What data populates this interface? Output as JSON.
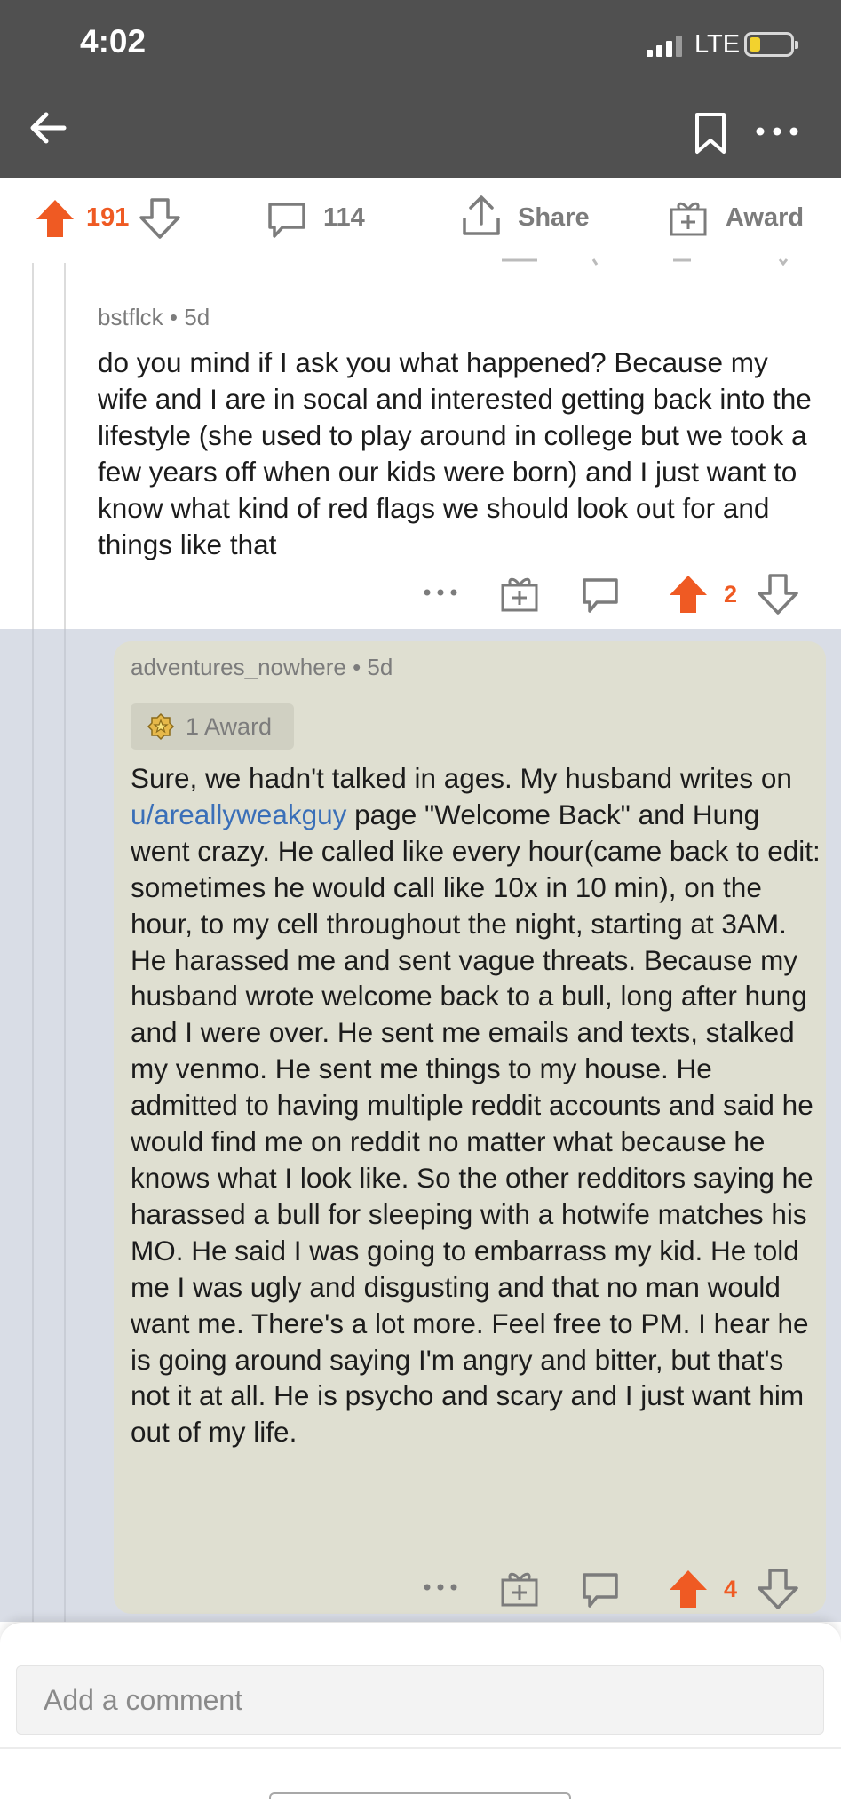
{
  "status_bar": {
    "time": "4:02",
    "network": "LTE"
  },
  "post_actions": {
    "score": "191",
    "comments": "114",
    "share_label": "Share",
    "award_label": "Award"
  },
  "comments": [
    {
      "author": "bstflck",
      "age": "5d",
      "body": "do you mind if I ask you what happened? Because my wife and I are in socal and interested getting back into the lifestyle (she used to play around in college but we took a few years off when our kids were born) and I just want to know what kind of red flags we should look out for and things like that",
      "score": "2"
    },
    {
      "author": "adventures_nowhere",
      "age": "5d",
      "award_chip": "1 Award",
      "body_parts": {
        "before_link": "Sure, we hadn't talked in ages. My husband writes on ",
        "link": "u/areallyweakguy",
        "after_link": " page \"Welcome Back\" and Hung went crazy. He called like every hour(came back to edit: sometimes he would call like 10x in 10 min), on the hour, to my cell throughout the night, starting at 3AM. He harassed me and sent vague threats. Because my husband wrote welcome back to a bull, long after hung and I were over. He sent me emails and texts, stalked my venmo. He sent me things to my house. He admitted to having multiple reddit accounts and said he would find me on reddit no matter what because he knows what I look like. So the other redditors saying he harassed a bull for sleeping with a hotwife matches his MO. He said I was going to embarrass my kid. He told me I was ugly and disgusting and that no man would want me. There's a lot more. Feel free to PM. I hear he is going around saying I'm angry and bitter, but that's not it at all. He is psycho and scary and I just want him out of my life."
      },
      "score": "4"
    }
  ],
  "composer": {
    "placeholder": "Add a comment"
  },
  "colors": {
    "header_bg": "#505050",
    "upvote_orange": "#ef5a23",
    "highlight_card": "#dfdfd1",
    "thread_highlight": "#d9dde6",
    "link_blue": "#3a6fb8"
  },
  "icons": [
    "back-arrow-icon",
    "bookmark-icon",
    "more-icon",
    "upvote-icon",
    "downvote-icon",
    "comment-icon",
    "share-icon",
    "award-icon",
    "reply-icon",
    "gift-icon",
    "award-badge-icon"
  ]
}
